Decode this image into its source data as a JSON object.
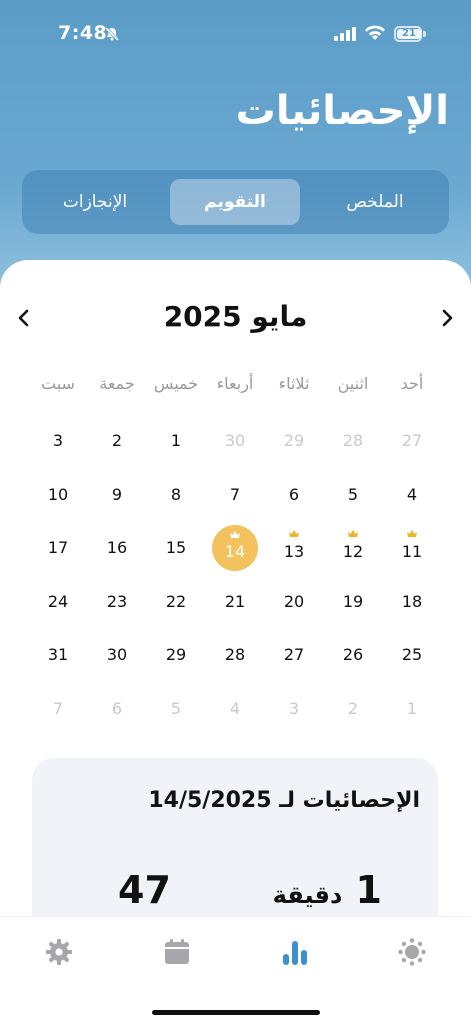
{
  "status": {
    "time": "7:48",
    "battery": "21"
  },
  "header": {
    "title": "الإحصائيات"
  },
  "tabs": [
    "الملخص",
    "التقويم",
    "الإنجازات"
  ],
  "calendar": {
    "month_title": "مايو 2025",
    "weekdays": [
      "أحد",
      "اثنين",
      "ثلاثاء",
      "أربعاء",
      "خميس",
      "جمعة",
      "سبت"
    ],
    "weeks": [
      [
        "27",
        "28",
        "29",
        "30",
        "1",
        "2",
        "3"
      ],
      [
        "4",
        "5",
        "6",
        "7",
        "8",
        "9",
        "10"
      ],
      [
        "11",
        "12",
        "13",
        "14",
        "15",
        "16",
        "17"
      ],
      [
        "18",
        "19",
        "20",
        "21",
        "22",
        "23",
        "24"
      ],
      [
        "25",
        "26",
        "27",
        "28",
        "29",
        "30",
        "31"
      ],
      [
        "1",
        "2",
        "3",
        "4",
        "5",
        "6",
        "7"
      ]
    ],
    "today": "14",
    "crowned_days": [
      "11",
      "12",
      "13",
      "14"
    ],
    "colors": {
      "accent": "#f3c15d",
      "crown": "#f0b429"
    }
  },
  "stats": {
    "title": "الإحصائيات لـ 14/5/2025",
    "minutes_value": "1",
    "minutes_unit": "دقيقة",
    "count_value": "47"
  },
  "tabbar": {
    "items": [
      "gear-icon",
      "calendar-icon",
      "bar-chart-icon",
      "sun-icon"
    ],
    "active": "bar-chart-icon",
    "active_color": "#3f8fcf",
    "inactive_color": "#a7a7ab"
  }
}
